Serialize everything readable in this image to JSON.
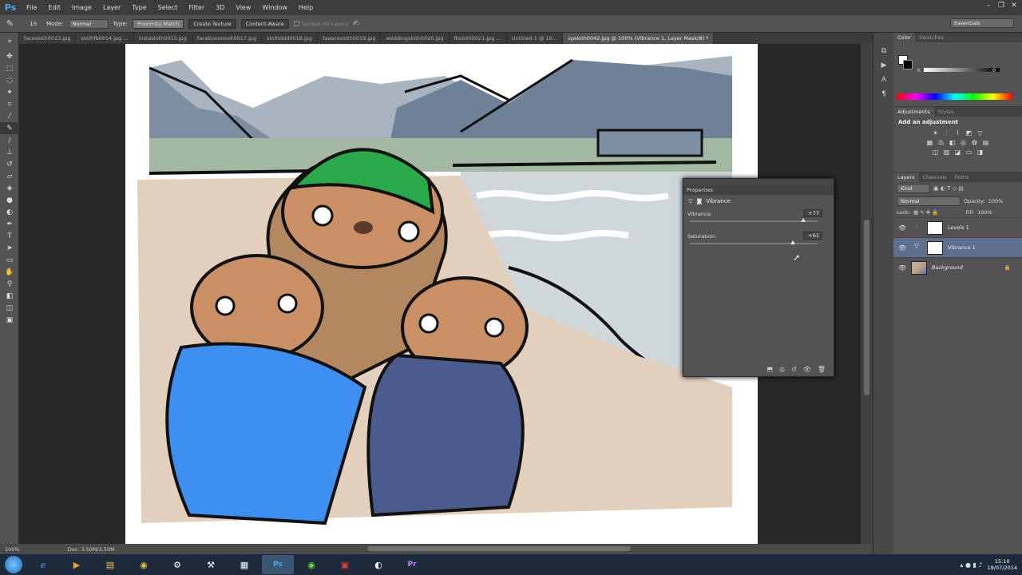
{
  "app": {
    "logo": "Ps"
  },
  "menu": [
    "File",
    "Edit",
    "Image",
    "Layer",
    "Type",
    "Select",
    "Filter",
    "3D",
    "View",
    "Window",
    "Help"
  ],
  "options_bar": {
    "mode_label": "Mode:",
    "mode_value": "Normal",
    "type_label": "Type:",
    "btn_proximity": "Proximity Match",
    "btn_texture": "Create Texture",
    "btn_content": "Content-Aware",
    "sample_all": "Sample All Layers",
    "brush_size": "10",
    "workspace": "Essentials"
  },
  "tabs": [
    "facesloth0013.jpg",
    "slothfb0014.jpg ...",
    "instasloth0015.jpg",
    "facebooooook0017.jpg",
    "slothddd0018.jpg",
    "faaacesloth0019.jpg",
    "weddingsloth0020.jpg",
    "fbsloth0021.jpg ...",
    "Untitled-1 @ 10...",
    "vpsloth0042.jpg @ 100% (Vibrance 1, Layer Mask/8) *"
  ],
  "status": {
    "zoom": "100%",
    "doc": "Doc: 3.50M/3.50M"
  },
  "color_panel": {
    "tab1": "Color",
    "tab2": "Swatches",
    "k_label": "K",
    "k_value": "0"
  },
  "adjustments": {
    "tab1": "Adjustments",
    "tab2": "Styles",
    "title": "Add an adjustment"
  },
  "layers_panel": {
    "tab1": "Layers",
    "tab2": "Channels",
    "tab3": "Paths",
    "kind": "Kind",
    "blend": "Normal",
    "opacity_label": "Opacity:",
    "opacity": "100%",
    "lock_label": "Lock:",
    "fill_label": "Fill:",
    "fill": "100%",
    "layers": [
      {
        "name": "Levels 1",
        "selected": false
      },
      {
        "name": "Vibrance 1",
        "selected": true
      },
      {
        "name": "Background",
        "selected": false
      }
    ]
  },
  "properties": {
    "tab": "Properties",
    "title": "Vibrance",
    "vibrance_label": "Vibrance:",
    "vibrance_value": "+77",
    "vibrance_level": 77,
    "saturation_label": "Saturation:",
    "saturation_value": "+61",
    "saturation_level": 61
  },
  "taskbar": {
    "time": "15:10",
    "date": "18/07/2014"
  },
  "colors": {
    "accent": "#4aa8e8",
    "selected_layer": "#5e6e8c"
  }
}
